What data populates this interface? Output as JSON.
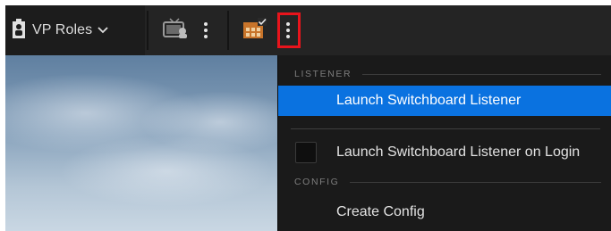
{
  "toolbar": {
    "vp_roles_label": "VP Roles",
    "icons": {
      "person": "person-badge-icon",
      "chevron": "chevron-down-icon",
      "tv": "tv-camera-icon",
      "switchboard": "switchboard-icon",
      "kebab": "more-options-icon"
    }
  },
  "menu": {
    "sections": [
      {
        "header": "LISTENER",
        "items": [
          {
            "label": "Launch Switchboard Listener",
            "active": true
          },
          {
            "label": "Launch Switchboard Listener on Login",
            "checkbox": true,
            "checked": false
          }
        ]
      },
      {
        "header": "CONFIG",
        "items": [
          {
            "label": "Create Config"
          }
        ]
      }
    ]
  },
  "colors": {
    "highlight": "#e8141c",
    "active_item": "#0a72e0",
    "toolbar_bg": "#242424",
    "menu_bg": "#1a1a1a"
  }
}
